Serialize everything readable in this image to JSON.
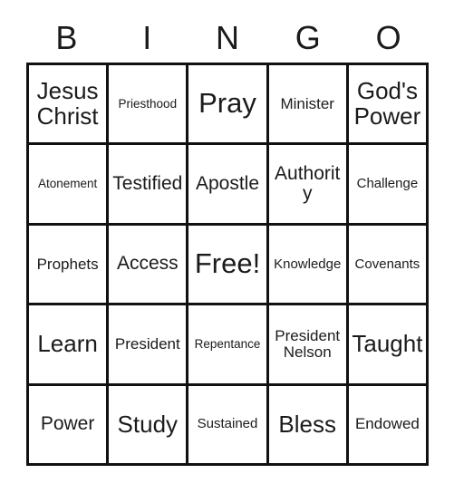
{
  "card": {
    "title": "BINGO",
    "header_letters": [
      "B",
      "I",
      "N",
      "G",
      "O"
    ],
    "colors": {
      "background": "#ffffff",
      "grid_line": "#111111",
      "text": "#1b1b1b"
    },
    "rows": [
      [
        {
          "label": "Jesus Christ",
          "size": "fs-lg",
          "free": false
        },
        {
          "label": "Priesthood",
          "size": "fs-xxs",
          "free": false
        },
        {
          "label": "Pray",
          "size": "fs-xl",
          "free": false
        },
        {
          "label": "Minister",
          "size": "fs-sm",
          "free": false
        },
        {
          "label": "God's Power",
          "size": "fs-lg",
          "free": false
        }
      ],
      [
        {
          "label": "Atonement",
          "size": "fs-xxs",
          "free": false
        },
        {
          "label": "Testified",
          "size": "fs-md",
          "free": false
        },
        {
          "label": "Apostle",
          "size": "fs-md",
          "free": false
        },
        {
          "label": "Authority",
          "size": "fs-md",
          "free": false
        },
        {
          "label": "Challenge",
          "size": "fs-xs",
          "free": false
        }
      ],
      [
        {
          "label": "Prophets",
          "size": "fs-sm",
          "free": false
        },
        {
          "label": "Access",
          "size": "fs-md",
          "free": false
        },
        {
          "label": "Free!",
          "size": "fs-xl",
          "free": true
        },
        {
          "label": "Knowledge",
          "size": "fs-xs",
          "free": false
        },
        {
          "label": "Covenants",
          "size": "fs-xs",
          "free": false
        }
      ],
      [
        {
          "label": "Learn",
          "size": "fs-lg",
          "free": false
        },
        {
          "label": "President",
          "size": "fs-sm",
          "free": false
        },
        {
          "label": "Repentance",
          "size": "fs-xxs",
          "free": false
        },
        {
          "label": "President Nelson",
          "size": "fs-sm",
          "free": false
        },
        {
          "label": "Taught",
          "size": "fs-lg",
          "free": false
        }
      ],
      [
        {
          "label": "Power",
          "size": "fs-md",
          "free": false
        },
        {
          "label": "Study",
          "size": "fs-lg",
          "free": false
        },
        {
          "label": "Sustained",
          "size": "fs-xs",
          "free": false
        },
        {
          "label": "Bless",
          "size": "fs-lg",
          "free": false
        },
        {
          "label": "Endowed",
          "size": "fs-sm",
          "free": false
        }
      ]
    ]
  }
}
